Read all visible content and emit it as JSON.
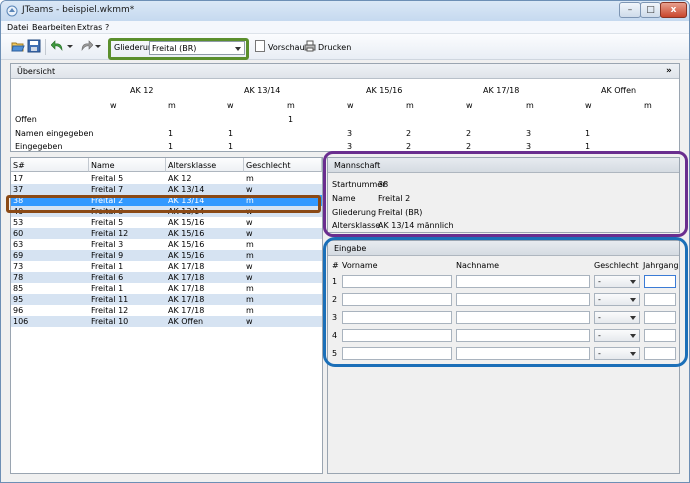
{
  "window": {
    "title": "JTeams - beispiel.wkmm*",
    "min_label": "–",
    "max_label": "□",
    "close_label": "x"
  },
  "menu": [
    {
      "label": "Datei"
    },
    {
      "label": "Bearbeiten"
    },
    {
      "label": "Extras"
    },
    {
      "label": "?"
    }
  ],
  "toolbar": {
    "gliederung_label": "Gliederung",
    "gliederung_value": "Freital (BR)",
    "vorschau_label": "Vorschau",
    "drucken_label": "Drucken"
  },
  "overview": {
    "title": "Übersicht",
    "groups": [
      "AK 12",
      "AK 13/14",
      "AK 15/16",
      "AK 17/18",
      "AK Offen"
    ],
    "genders": [
      "w",
      "m",
      "w",
      "m",
      "w",
      "m",
      "w",
      "m",
      "w",
      "m"
    ],
    "rows": [
      {
        "label": "Offen",
        "values": [
          "",
          "",
          "",
          "1",
          "",
          "",
          "",
          "",
          "",
          ""
        ]
      },
      {
        "label": "Namen eingegeben",
        "values": [
          "",
          "1",
          "1",
          "",
          "3",
          "2",
          "2",
          "3",
          "1",
          ""
        ]
      },
      {
        "label": "Eingegeben",
        "values": [
          "",
          "1",
          "1",
          "",
          "3",
          "2",
          "2",
          "3",
          "1",
          ""
        ]
      }
    ]
  },
  "table": {
    "headers": [
      "S#",
      "Name",
      "Altersklasse",
      "Geschlecht"
    ],
    "rows": [
      [
        "17",
        "Freital 5",
        "AK 12",
        "m"
      ],
      [
        "37",
        "Freital 7",
        "AK 13/14",
        "w"
      ],
      [
        "38",
        "Freital 2",
        "AK 13/14",
        "m"
      ],
      [
        "40",
        "Freital 8",
        "AK 13/14",
        "w"
      ],
      [
        "53",
        "Freital 5",
        "AK 15/16",
        "w"
      ],
      [
        "60",
        "Freital 12",
        "AK 15/16",
        "w"
      ],
      [
        "63",
        "Freital 3",
        "AK 15/16",
        "m"
      ],
      [
        "69",
        "Freital 9",
        "AK 15/16",
        "m"
      ],
      [
        "73",
        "Freital 1",
        "AK 17/18",
        "w"
      ],
      [
        "78",
        "Freital 6",
        "AK 17/18",
        "w"
      ],
      [
        "85",
        "Freital 1",
        "AK 17/18",
        "m"
      ],
      [
        "95",
        "Freital 11",
        "AK 17/18",
        "m"
      ],
      [
        "96",
        "Freital 12",
        "AK 17/18",
        "m"
      ],
      [
        "106",
        "Freital 10",
        "AK Offen",
        "w"
      ]
    ],
    "selected_index": 2
  },
  "mannschaft": {
    "title": "Mannschaft",
    "fields": [
      {
        "label": "Startnummer",
        "value": "38"
      },
      {
        "label": "Name",
        "value": "Freital 2"
      },
      {
        "label": "Gliederung",
        "value": "Freital (BR)"
      },
      {
        "label": "Altersklasse",
        "value": "AK 13/14 männlich"
      }
    ]
  },
  "eingabe": {
    "title": "Eingabe",
    "headers": {
      "num": "#",
      "vorname": "Vorname",
      "nachname": "Nachname",
      "geschlecht": "Geschlecht",
      "jahrgang": "Jahrgang"
    },
    "rows": [
      {
        "num": "1",
        "geschlecht": "-"
      },
      {
        "num": "2",
        "geschlecht": "-"
      },
      {
        "num": "3",
        "geschlecht": "-"
      },
      {
        "num": "4",
        "geschlecht": "-"
      },
      {
        "num": "5",
        "geschlecht": "-"
      }
    ]
  },
  "colors": {
    "selection": "#3399ff",
    "alt_row": "#d6e3f2",
    "green_box": "#5b8f2d",
    "brown_box": "#8b4a16",
    "purple_box": "#6a2e8f",
    "blue_box": "#1b6fb8"
  }
}
